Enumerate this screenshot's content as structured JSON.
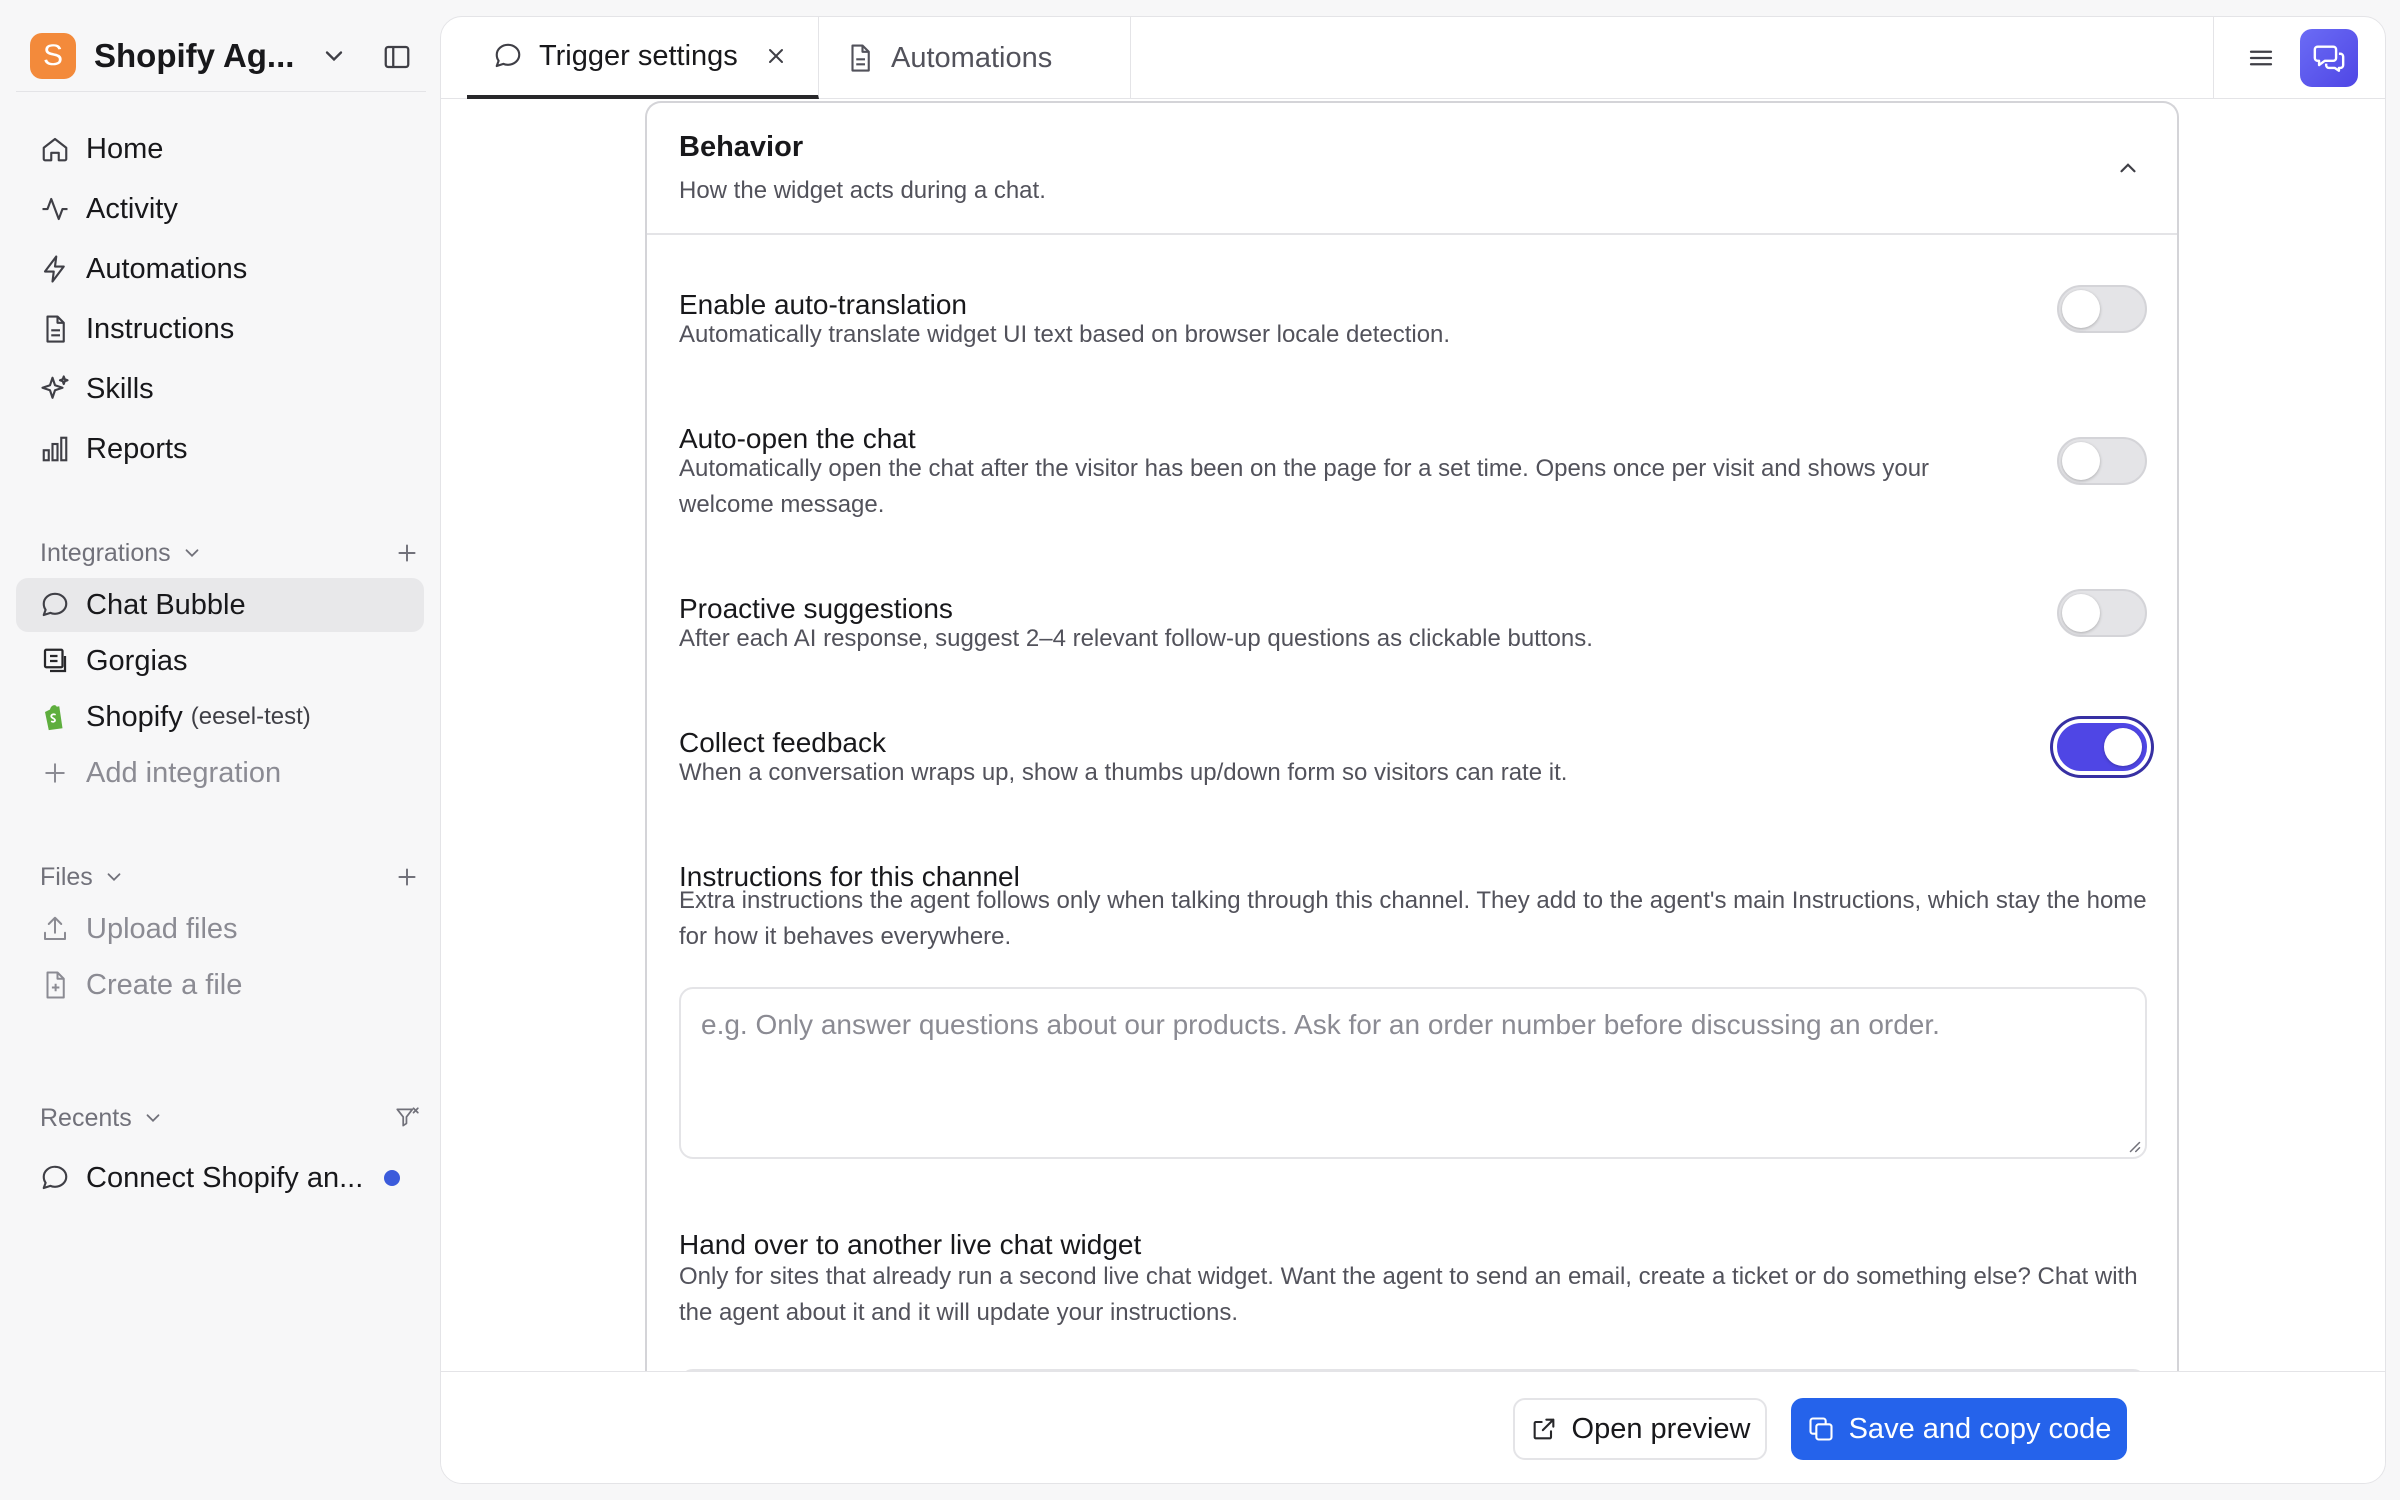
{
  "workspace": {
    "logo_letter": "S",
    "name": "Shopify Ag..."
  },
  "nav": [
    {
      "label": "Home",
      "icon": "home-icon"
    },
    {
      "label": "Activity",
      "icon": "activity-icon"
    },
    {
      "label": "Automations",
      "icon": "lightning-icon"
    },
    {
      "label": "Instructions",
      "icon": "document-icon"
    },
    {
      "label": "Skills",
      "icon": "sparkles-icon"
    },
    {
      "label": "Reports",
      "icon": "bar-chart-icon"
    }
  ],
  "integrations": {
    "heading": "Integrations",
    "items": [
      {
        "label": "Chat Bubble",
        "icon": "chat-bubble-icon",
        "active": true
      },
      {
        "label": "Gorgias",
        "icon": "gorgias-icon"
      },
      {
        "label": "Shopify",
        "sub": "(eesel-test)",
        "icon": "shopify-icon"
      },
      {
        "label": "Add integration",
        "icon": "plus-icon"
      }
    ]
  },
  "files": {
    "heading": "Files",
    "items": [
      {
        "label": "Upload files",
        "icon": "upload-icon"
      },
      {
        "label": "Create a file",
        "icon": "file-plus-icon"
      }
    ]
  },
  "recents": {
    "heading": "Recents",
    "items": [
      {
        "label": "Connect Shopify an...",
        "icon": "chat-bubble-icon",
        "unread": true
      }
    ]
  },
  "tabs": [
    {
      "label": "Trigger settings",
      "active": true
    },
    {
      "label": "Automations",
      "active": false
    }
  ],
  "card": {
    "title": "Behavior",
    "subtitle": "How the widget acts during a chat.",
    "settings": [
      {
        "title": "Enable auto-translation",
        "desc": "Automatically translate widget UI text based on browser locale detection.",
        "enabled": false
      },
      {
        "title": "Auto-open the chat",
        "desc": "Automatically open the chat after the visitor has been on the page for a set time. Opens once per visit and shows your welcome message.",
        "enabled": false
      },
      {
        "title": "Proactive suggestions",
        "desc": "After each AI response, suggest 2–4 relevant follow-up questions as clickable buttons.",
        "enabled": false
      },
      {
        "title": "Collect feedback",
        "desc": "When a conversation wraps up, show a thumbs up/down form so visitors can rate it.",
        "enabled": true
      }
    ],
    "instructions": {
      "title": "Instructions for this channel",
      "desc": "Extra instructions the agent follows only when talking through this channel. They add to the agent's main Instructions, which stay the home for how it behaves everywhere.",
      "placeholder": "e.g. Only answer questions about our products. Ask for an order number before discussing an order.",
      "value": ""
    },
    "handover": {
      "title": "Hand over to another live chat widget",
      "desc": "Only for sites that already run a second live chat widget. Want the agent to send an email, create a ticket or do something else? Chat with the agent about it and it will update your instructions."
    }
  },
  "footer": {
    "preview_label": "Open preview",
    "save_label": "Save and copy code"
  },
  "colors": {
    "accent": "#4f46e5",
    "primary_button": "#2563eb",
    "logo": "#f38a3b",
    "unread_dot": "#3b5bdb"
  }
}
